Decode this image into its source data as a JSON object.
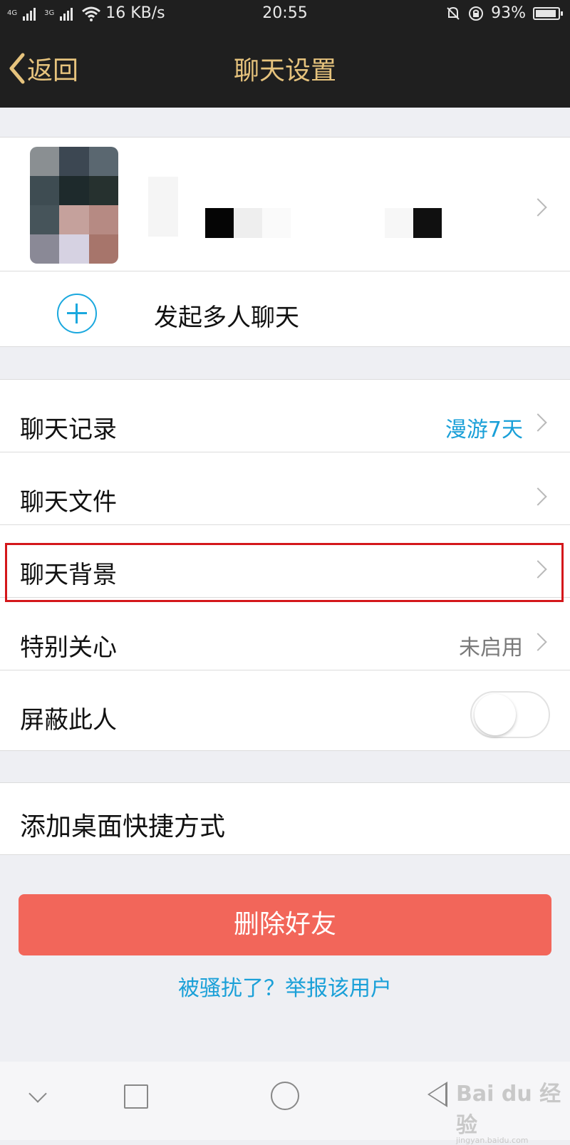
{
  "status_bar": {
    "network_1": "4G",
    "network_2": "3G",
    "speed": "16 KB/s",
    "time": "20:55",
    "battery": "93%",
    "battery_level": 0.93
  },
  "nav": {
    "back_label": "返回",
    "title": "聊天设置"
  },
  "group_chat": {
    "label": "发起多人聊天"
  },
  "settings": [
    {
      "label": "聊天记录",
      "value": "漫游7天"
    },
    {
      "label": "聊天文件",
      "value": ""
    },
    {
      "label": "聊天背景",
      "value": ""
    },
    {
      "label": "特别关心",
      "value": "未启用"
    },
    {
      "label": "屏蔽此人",
      "toggle": false
    }
  ],
  "shortcut": {
    "label": "添加桌面快捷方式"
  },
  "actions": {
    "delete_label": "删除好友",
    "report_label": "被骚扰了？举报该用户"
  },
  "watermark": {
    "brand": "Bai du 经验",
    "url": "jingyan.baidu.com"
  },
  "colors": {
    "accent_blue": "#1aa0d8",
    "delete_red": "#f2665a",
    "nav_gold": "#e6c37d",
    "highlight_frame": "#d4171b"
  }
}
